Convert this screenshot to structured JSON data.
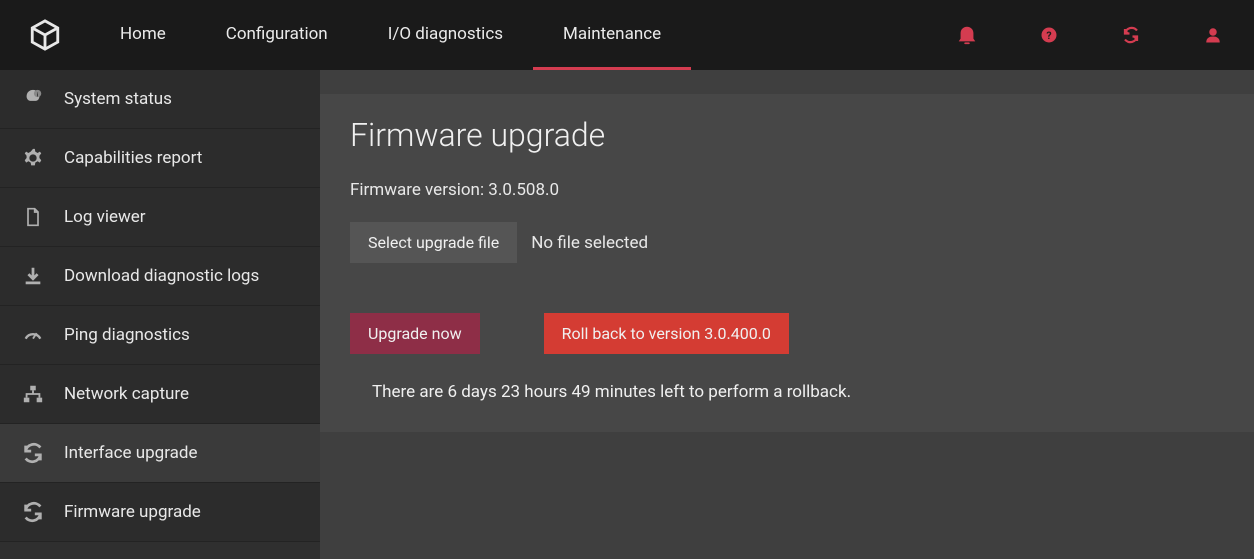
{
  "nav": {
    "items": [
      {
        "label": "Home"
      },
      {
        "label": "Configuration"
      },
      {
        "label": "I/O diagnostics"
      },
      {
        "label": "Maintenance"
      }
    ]
  },
  "sidebar": {
    "items": [
      {
        "label": "System status",
        "icon": "info-badge-icon"
      },
      {
        "label": "Capabilities report",
        "icon": "gear-icon"
      },
      {
        "label": "Log viewer",
        "icon": "file-icon"
      },
      {
        "label": "Download diagnostic logs",
        "icon": "download-icon"
      },
      {
        "label": "Ping diagnostics",
        "icon": "gauge-icon"
      },
      {
        "label": "Network capture",
        "icon": "network-icon"
      },
      {
        "label": "Interface upgrade",
        "icon": "refresh-icon"
      },
      {
        "label": "Firmware upgrade",
        "icon": "refresh-icon"
      }
    ]
  },
  "main": {
    "title": "Firmware upgrade",
    "fw_label": "Firmware version:",
    "fw_version": "3.0.508.0",
    "select_file_label": "Select upgrade file",
    "file_status": "No file selected",
    "upgrade_label": "Upgrade now",
    "rollback_label": "Roll back to version 3.0.400.0",
    "rollback_info": "There are 6 days 23 hours 49 minutes left to perform a rollback."
  }
}
